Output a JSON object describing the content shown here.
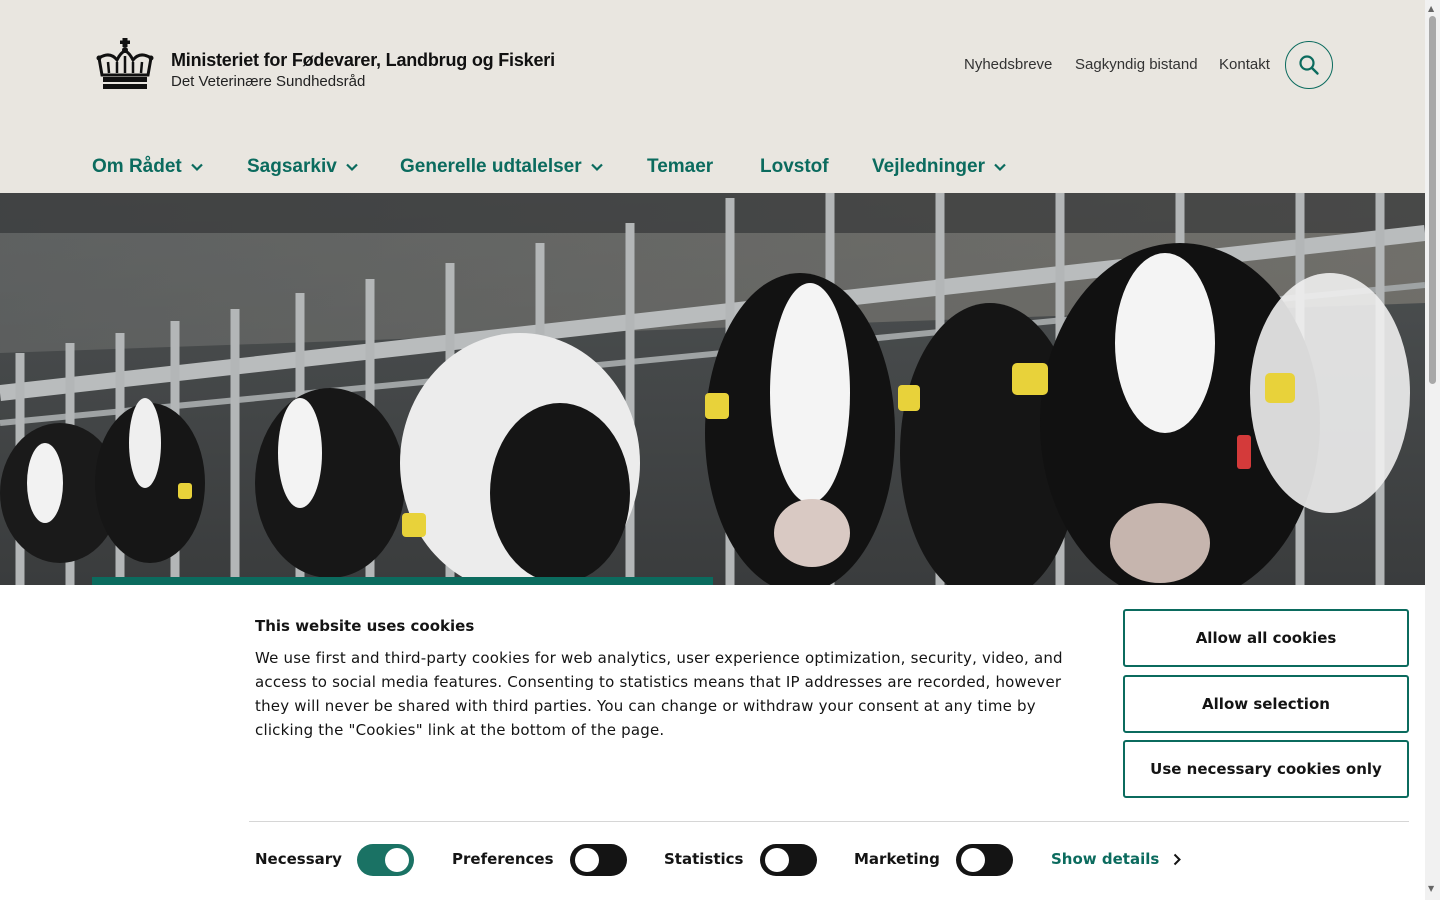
{
  "header": {
    "title": "Ministeriet for Fødevarer, Landbrug og Fiskeri",
    "subtitle": "Det Veterinære Sundhedsråd",
    "utility_nav": [
      "Nyhedsbreve",
      "Sagkyndig bistand",
      "Kontakt"
    ],
    "search_icon": "search-icon",
    "logo_icon": "crown-icon"
  },
  "main_nav": [
    {
      "label": "Om Rådet",
      "has_dropdown": true
    },
    {
      "label": "Sagsarkiv",
      "has_dropdown": true
    },
    {
      "label": "Generelle udtalelser",
      "has_dropdown": true
    },
    {
      "label": "Temaer",
      "has_dropdown": false
    },
    {
      "label": "Lovstof",
      "has_dropdown": false
    },
    {
      "label": "Vejledninger",
      "has_dropdown": true
    }
  ],
  "hero": {
    "image_subject": "cows"
  },
  "cookie_banner": {
    "title": "This website uses cookies",
    "text": "We use first and third-party cookies for web analytics, user experience optimization, security, video, and access to social media features. Consenting to statistics means that IP addresses are recorded, however they will never be shared with third parties. You can change or withdraw your consent at any time by clicking the \"Cookies\" link at the bottom of the page.",
    "buttons": {
      "allow_all": "Allow all cookies",
      "allow_selection": "Allow selection",
      "necessary_only": "Use necessary cookies only"
    },
    "toggles": [
      {
        "label": "Necessary",
        "on": true
      },
      {
        "label": "Preferences",
        "on": false
      },
      {
        "label": "Statistics",
        "on": false
      },
      {
        "label": "Marketing",
        "on": false
      }
    ],
    "show_details": "Show details"
  },
  "colors": {
    "accent": "#0b6b5e",
    "header_bg": "#e9e6e0",
    "toggle_on": "#1a7264",
    "toggle_off": "#141414"
  }
}
